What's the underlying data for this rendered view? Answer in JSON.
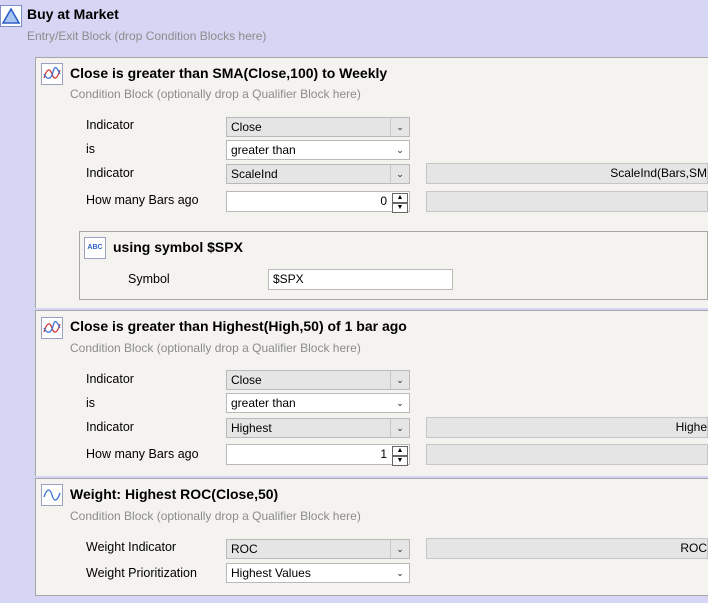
{
  "entry_block": {
    "title": "Buy at Market",
    "subtitle": "Entry/Exit Block (drop Condition Blocks here)"
  },
  "conditions": [
    {
      "title": "Close is greater than SMA(Close,100) to Weekly",
      "subtitle": "Condition Block (optionally drop a Qualifier Block here)",
      "rows": {
        "indicator1_label": "Indicator",
        "indicator1_value": "Close",
        "is_label": "is",
        "is_value": "greater than",
        "indicator2_label": "Indicator",
        "indicator2_value": "ScaleInd",
        "indicator2_params": "ScaleInd(Bars,SM",
        "bars_ago_label": "How many Bars ago",
        "bars_ago_value": "0"
      },
      "qualifier": {
        "icon_text": "ABC",
        "title": "using symbol $SPX",
        "symbol_label": "Symbol",
        "symbol_value": "$SPX"
      }
    },
    {
      "title": "Close is greater than Highest(High,50) of 1 bar ago",
      "subtitle": "Condition Block (optionally drop a Qualifier Block here)",
      "rows": {
        "indicator1_label": "Indicator",
        "indicator1_value": "Close",
        "is_label": "is",
        "is_value": "greater than",
        "indicator2_label": "Indicator",
        "indicator2_value": "Highest",
        "indicator2_params": "Highe",
        "bars_ago_label": "How many Bars ago",
        "bars_ago_value": "1"
      }
    },
    {
      "title": "Weight: Highest ROC(Close,50)",
      "subtitle": "Condition Block (optionally drop a Qualifier Block here)",
      "rows": {
        "weight_indicator_label": "Weight Indicator",
        "weight_indicator_value": "ROC",
        "weight_indicator_params": "ROC",
        "weight_prior_label": "Weight Prioritization",
        "weight_prior_value": "Highest Values"
      }
    }
  ],
  "icons": {
    "entry": "triangle-up-icon",
    "condition": "chart-lines-icon",
    "weight": "wave-icon",
    "dropdown": "chevron-down-icon",
    "spinner": "spin-updown-icon"
  },
  "colors": {
    "background": "#d6d5f3",
    "panel": "#f5f3ef",
    "entry_icon": "#3b6fd9",
    "condition_icon_red": "#d43b3b",
    "condition_icon_blue": "#3b6fd9"
  }
}
